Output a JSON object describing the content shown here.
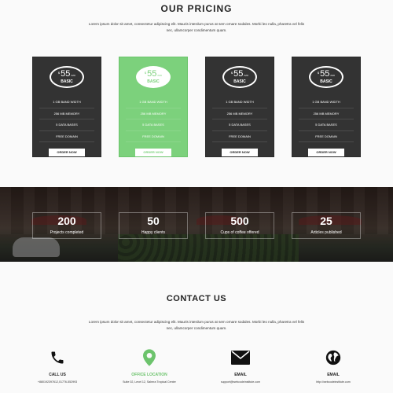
{
  "pricing": {
    "title": "OUR PRICING",
    "intro": "Lorem ipsum dolor sit amet, consectetur adipiscing elit. Mauris interdum purus at sem ornare sodales. Morbi leo nulla, pharetra vel felis nec, ullamcorper condimentum quam.",
    "plans": [
      {
        "currency": "$",
        "price": "55",
        "period": "/MO",
        "name": "BASIC",
        "features": [
          "1 GB BAND WIDTH",
          "256 MB MEMORY",
          "5 DATA BASES",
          "FREE DOMAIN"
        ],
        "button": "ORDER NOW"
      },
      {
        "currency": "$",
        "price": "55",
        "period": "/MO",
        "name": "BASIC",
        "features": [
          "1 GB BAND WIDTH",
          "256 MB MEMORY",
          "5 DATA BASES",
          "FREE DOMAIN"
        ],
        "button": "ORDER NOW"
      },
      {
        "currency": "$",
        "price": "55",
        "period": "/MO",
        "name": "BASIC",
        "features": [
          "1 GB BAND WIDTH",
          "256 MB MEMORY",
          "5 DATA BASES",
          "FREE DOMAIN"
        ],
        "button": "ORDER NOW"
      },
      {
        "currency": "$",
        "price": "55",
        "period": "/MO",
        "name": "BASIC",
        "features": [
          "1 GB BAND WIDTH",
          "256 MB MEMORY",
          "5 DATA BASES",
          "FREE DOMAIN"
        ],
        "button": "ORDER NOW"
      }
    ],
    "featured_index": 1,
    "colors": {
      "card_dark": "#333333",
      "card_featured": "#7cd17c"
    }
  },
  "stats": [
    {
      "value": "200",
      "label": "Projects completed"
    },
    {
      "value": "50",
      "label": "Happy clients"
    },
    {
      "value": "500",
      "label": "Cups of coffee offered"
    },
    {
      "value": "25",
      "label": "Articles published"
    }
  ],
  "contact": {
    "title": "CONTACT US",
    "intro": "Lorem ipsum dolor sit amet, consectetur adipiscing elit. Mauris interdum purus at sem ornare sodales. Morbi leo nulla, pharetra vel felis nec, ullamcorper condimentum quam.",
    "items": [
      {
        "icon": "phone-icon",
        "label": "CALL US",
        "value": "+880192397612,01776-552993"
      },
      {
        "icon": "location-pin-icon",
        "label": "OFFICE LOCATION",
        "value": "Suite 02, Level 12, Sahera Tropical Center"
      },
      {
        "icon": "envelope-icon",
        "label": "EMAIL",
        "value": "support@webcodeinstitute.com"
      },
      {
        "icon": "globe-icon",
        "label": "EMAIL",
        "value": "http://webcodeinstitute.com"
      }
    ],
    "accent_color": "#6cc36c"
  }
}
